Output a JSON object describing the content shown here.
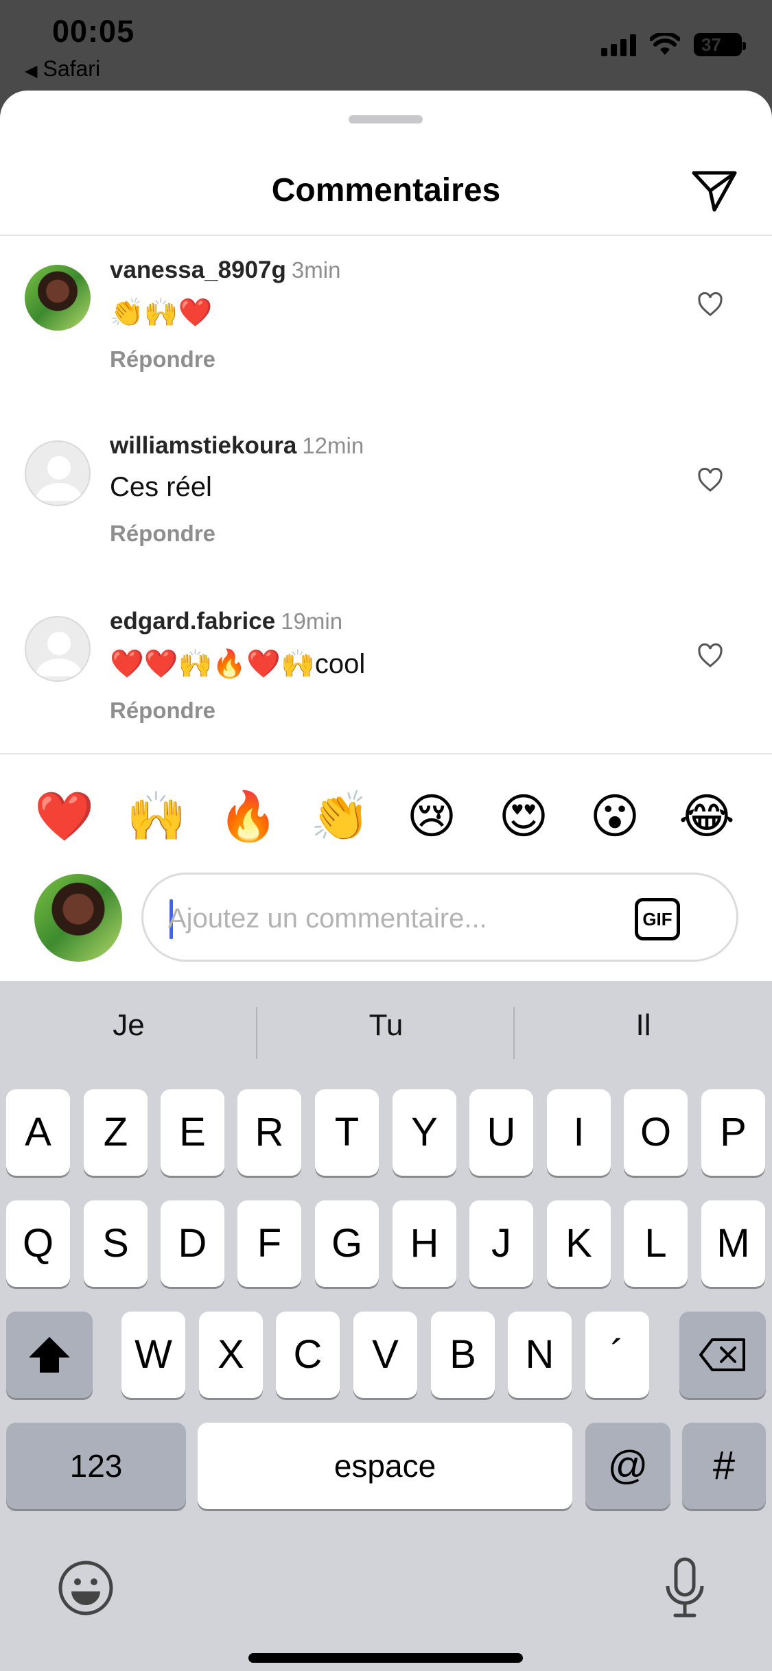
{
  "status_bar": {
    "time": "00:05",
    "back_app": "Safari",
    "battery_level": "37"
  },
  "sheet": {
    "title": "Commentaires"
  },
  "comments": [
    {
      "username": "vanessa_8907g",
      "time": "3min",
      "text": "👏🙌❤️",
      "reply_label": "Répondre"
    },
    {
      "username": "williamstiekoura",
      "time": "12min",
      "text": "Ces réel",
      "reply_label": "Répondre"
    },
    {
      "username": "edgard.fabrice",
      "time": "19min",
      "text": "❤️❤️🙌🔥❤️🙌cool",
      "reply_label": "Répondre"
    }
  ],
  "quick_reactions": [
    "❤️",
    "🙌",
    "🔥",
    "👏",
    "😢",
    "😍",
    "😮",
    "😂"
  ],
  "composer": {
    "placeholder": "Ajoutez un commentaire...",
    "value": "",
    "gif_label": "GIF"
  },
  "keyboard": {
    "suggestions": [
      "Je",
      "Tu",
      "Il"
    ],
    "row1": [
      "A",
      "Z",
      "E",
      "R",
      "T",
      "Y",
      "U",
      "I",
      "O",
      "P"
    ],
    "row2": [
      "Q",
      "S",
      "D",
      "F",
      "G",
      "H",
      "J",
      "K",
      "L",
      "M"
    ],
    "row3": [
      "W",
      "X",
      "C",
      "V",
      "B",
      "N",
      "´"
    ],
    "numbers_label": "123",
    "space_label": "espace",
    "at_label": "@",
    "hash_label": "#"
  }
}
